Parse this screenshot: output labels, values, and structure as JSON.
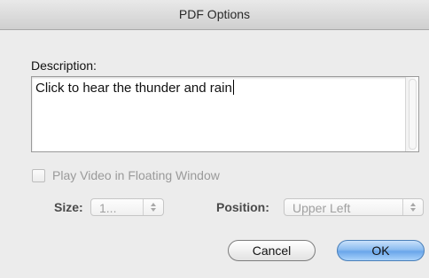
{
  "window": {
    "title": "PDF Options"
  },
  "description": {
    "label": "Description:",
    "value": "Click to hear the thunder and rain"
  },
  "floating_window": {
    "label": "Play Video in Floating Window",
    "checked": false,
    "enabled": false
  },
  "size": {
    "label": "Size:",
    "value": "1...",
    "enabled": false
  },
  "position": {
    "label": "Position:",
    "value": "Upper Left",
    "enabled": false
  },
  "buttons": {
    "cancel": "Cancel",
    "ok": "OK"
  },
  "colors": {
    "default_button": "#6aa6ea",
    "disabled_text": "#9a9a9a"
  }
}
